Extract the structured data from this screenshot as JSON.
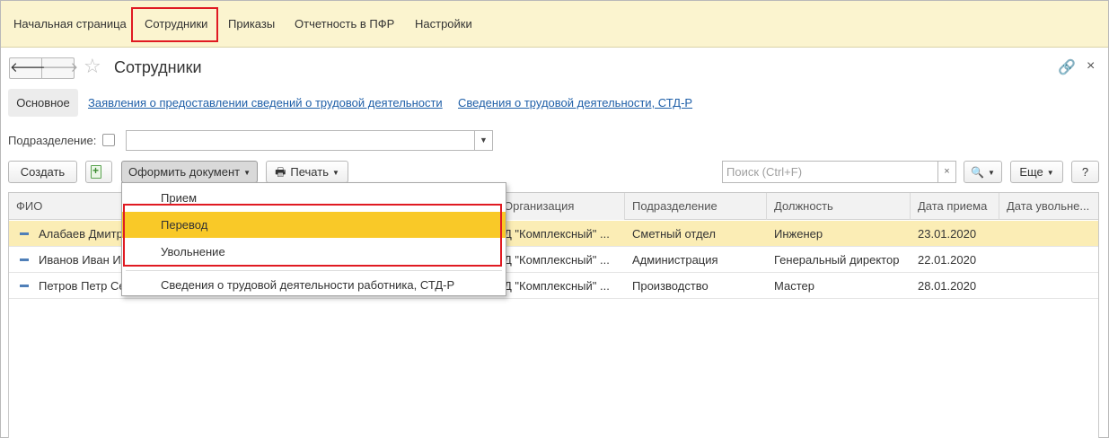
{
  "top_menu": {
    "items": [
      "Начальная страница",
      "Сотрудники",
      "Приказы",
      "Отчетность в ПФР",
      "Настройки"
    ]
  },
  "header": {
    "back": "🡐",
    "forward": "🡒",
    "star": "☆",
    "title": "Сотрудники",
    "link_glyph": "🔗",
    "close_glyph": "×"
  },
  "sections": {
    "main": "Основное",
    "link1": "Заявления о предоставлении сведений о трудовой деятельности",
    "link2": "Сведения о трудовой деятельности, СТД-Р"
  },
  "filter": {
    "label": "Подразделение:",
    "value": "",
    "drop_glyph": "▼"
  },
  "toolbar": {
    "create": "Создать",
    "make_document": "Оформить документ",
    "print": "Печать",
    "print_glyph": "🖶",
    "search_placeholder": "Поиск (Ctrl+F)",
    "search_clear": "×",
    "search_glyph": "🔍",
    "more": "Еще",
    "help": "?",
    "caret": "▼"
  },
  "table": {
    "columns": [
      "ФИО",
      "Организация",
      "Подразделение",
      "Должность",
      "Дата приема",
      "Дата увольне..."
    ],
    "rows": [
      {
        "fio": "Алабаев Дмитр",
        "org": "Д \"Комплексный\" ...",
        "dept": "Сметный отдел",
        "position": "Инженер",
        "hired": "23.01.2020",
        "fired": ""
      },
      {
        "fio": "Иванов Иван И",
        "org": "Д \"Комплексный\" ...",
        "dept": "Администрация",
        "position": "Генеральный директор",
        "hired": "22.01.2020",
        "fired": ""
      },
      {
        "fio": "Петров Петр Се",
        "org": "Д \"Комплексный\" ...",
        "dept": "Производство",
        "position": "Мастер",
        "hired": "28.01.2020",
        "fired": ""
      }
    ]
  },
  "dropdown": {
    "items": [
      "Прием",
      "Перевод",
      "Увольнение",
      "Сведения о трудовой деятельности работника, СТД-Р"
    ]
  },
  "colors": {
    "top_menu_bg": "#fbf4cf",
    "selected_row": "#fbedb5",
    "menu_active": "#f9c928",
    "highlight_red": "#e01a22",
    "link": "#1f5fa8"
  }
}
